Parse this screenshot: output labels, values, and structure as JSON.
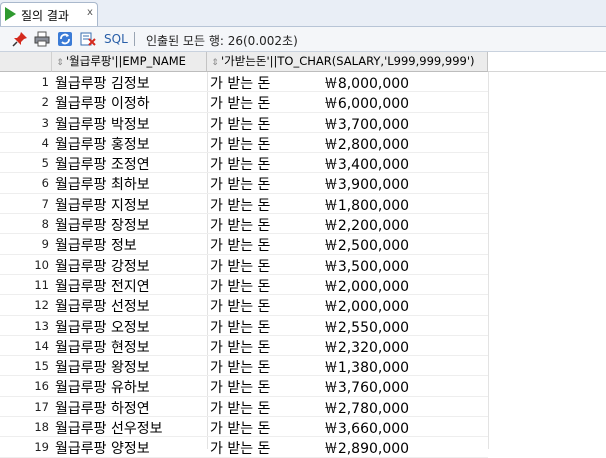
{
  "tab": {
    "label": "질의 결과",
    "close": "x"
  },
  "toolbar": {
    "sql_label": "SQL",
    "status": "인출된 모든 행: 26(0.002초)"
  },
  "columns": [
    {
      "label": "'월급루팡'||EMP_NAME"
    },
    {
      "label": "'가받는돈'||TO_CHAR(SALARY,'L999,999,999')"
    }
  ],
  "rows": [
    {
      "num": "1",
      "c1": "월급루팡 김정보",
      "c2": "가 받는 돈            ￦8,000,000"
    },
    {
      "num": "2",
      "c1": "월급루팡 이정하",
      "c2": "가 받는 돈            ￦6,000,000"
    },
    {
      "num": "3",
      "c1": "월급루팡 박정보",
      "c2": "가 받는 돈            ￦3,700,000"
    },
    {
      "num": "4",
      "c1": "월급루팡 홍정보",
      "c2": "가 받는 돈            ￦2,800,000"
    },
    {
      "num": "5",
      "c1": "월급루팡 조정연",
      "c2": "가 받는 돈            ￦3,400,000"
    },
    {
      "num": "6",
      "c1": "월급루팡 최하보",
      "c2": "가 받는 돈            ￦3,900,000"
    },
    {
      "num": "7",
      "c1": "월급루팡 지정보",
      "c2": "가 받는 돈            ￦1,800,000"
    },
    {
      "num": "8",
      "c1": "월급루팡 장정보",
      "c2": "가 받는 돈            ￦2,200,000"
    },
    {
      "num": "9",
      "c1": "월급루팡 정보",
      "c2": "가 받는 돈            ￦2,500,000"
    },
    {
      "num": "10",
      "c1": "월급루팡 강정보",
      "c2": "가 받는 돈            ￦3,500,000"
    },
    {
      "num": "11",
      "c1": "월급루팡 전지연",
      "c2": "가 받는 돈            ￦2,000,000"
    },
    {
      "num": "12",
      "c1": "월급루팡 선정보",
      "c2": "가 받는 돈            ￦2,000,000"
    },
    {
      "num": "13",
      "c1": "월급루팡 오정보",
      "c2": "가 받는 돈            ￦2,550,000"
    },
    {
      "num": "14",
      "c1": "월급루팡 현정보",
      "c2": "가 받는 돈            ￦2,320,000"
    },
    {
      "num": "15",
      "c1": "월급루팡 왕정보",
      "c2": "가 받는 돈            ￦1,380,000"
    },
    {
      "num": "16",
      "c1": "월급루팡 유하보",
      "c2": "가 받는 돈            ￦3,760,000"
    },
    {
      "num": "17",
      "c1": "월급루팡 하정연",
      "c2": "가 받는 돈            ￦2,780,000"
    },
    {
      "num": "18",
      "c1": "월급루팡 선우정보",
      "c2": "가 받는 돈            ￦3,660,000"
    },
    {
      "num": "19",
      "c1": "월급루팡 양정보",
      "c2": "가 받는 돈            ￦2,890,000"
    }
  ]
}
